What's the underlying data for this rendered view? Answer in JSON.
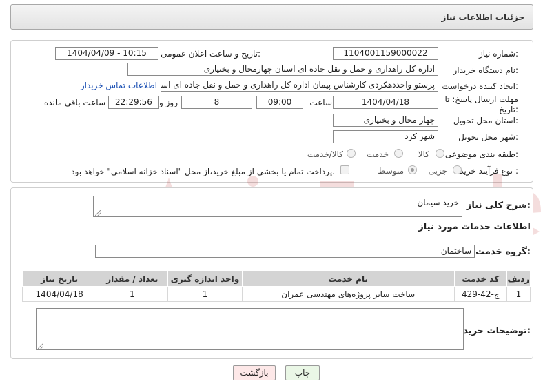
{
  "header": {
    "title": "جزئیات اطلاعات نیاز"
  },
  "form": {
    "need_number_label": "شماره نیاز:",
    "need_number": "1104001159000022",
    "announce_label": "تاریخ و ساعت اعلان عمومی:",
    "announce_value": "1404/04/09 - 10:15",
    "buyer_org_label": "نام دستگاه خریدار:",
    "buyer_org": "اداره کل راهداری و حمل و نقل جاده ای استان چهارمحال و بختیاری",
    "creator_label": "ایجاد کننده درخواست:",
    "creator": "پرستو واحددهکردی کارشناس پیمان اداره کل راهداری و حمل و نقل جاده ای است",
    "contact_link": "اطلاعات تماس خریدار",
    "deadline_label_1": "مهلت ارسال پاسخ: تا",
    "deadline_label_2": "تاریخ:",
    "deadline_date": "1404/04/18",
    "time_label": "ساعت",
    "deadline_time": "09:00",
    "days_value": "8",
    "day_label": "روز و",
    "remaining_time": "22:29:56",
    "remaining_label": "ساعت باقی مانده",
    "province_label": "استان محل تحویل:",
    "province": "چهار محال و بختیاری",
    "city_label": "شهر محل تحویل:",
    "city": "شهر کرد",
    "category_label": "طبقه بندی موضوعی:",
    "category_options": [
      "کالا",
      "خدمت",
      "کالا/خدمت"
    ],
    "purchase_type_label": "نوع فرآیند خرید :",
    "purchase_options": [
      "جزیی",
      "متوسط"
    ],
    "payment_note": "پرداخت تمام یا بخشی از مبلغ خرید،از محل \"اسناد خزانه اسلامی\" خواهد بود."
  },
  "summary": {
    "label": "شرح کلی نیاز:",
    "value": "خرید سیمان"
  },
  "services": {
    "title": "اطلاعات خدمات مورد نیاز",
    "group_label": "گروه خدمت:",
    "group_value": "ساختمان",
    "columns": [
      "ردیف",
      "کد خدمت",
      "نام خدمت",
      "واحد اندازه گیری",
      "تعداد / مقدار",
      "تاریخ نیاز"
    ],
    "rows": [
      [
        "1",
        "ج-42-429",
        "ساخت سایر پروژه‌های مهندسی عمران",
        "1",
        "1",
        "1404/04/18"
      ]
    ]
  },
  "buyer_notes": {
    "label": "توضیحات خریدار:"
  },
  "buttons": {
    "print": "چاپ",
    "back": "بازگشت"
  },
  "colors": {
    "back_button_bg": "#fde8e8",
    "print_button_bg": "#eaf7e6",
    "watermark": "#b30000"
  }
}
